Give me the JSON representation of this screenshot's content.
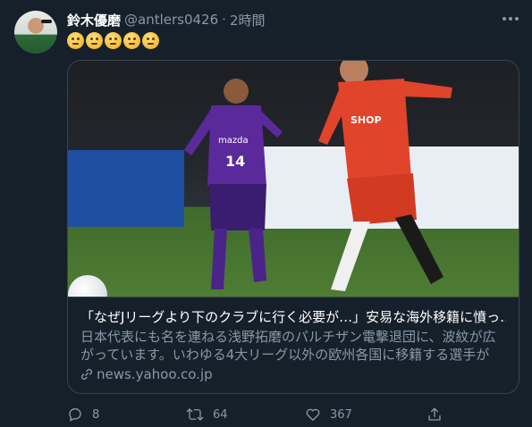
{
  "tweet": {
    "display_name": "鈴木優磨",
    "handle": "@antlers0426",
    "separator": "·",
    "time": "2時間",
    "emoji_icons": [
      "thinking-face-emoji",
      "thinking-face-emoji",
      "thinking-face-emoji",
      "thinking-face-emoji",
      "thinking-face-emoji"
    ]
  },
  "card": {
    "title": "「なぜJリーグより下のクラブに行く必要が…」安易な海外移籍に憤っ…",
    "description": "日本代表にも名を連ねる浅野拓磨のパルチザン電撃退団に、波紋が広がっています。いわゆる4大リーグ以外の欧州各国に移籍する選手が増…",
    "link": "news.yahoo.co.jp",
    "photo_text": {
      "player1_number": "14",
      "player1_sponsor": "mazda",
      "player2_sponsor": "SHOP"
    }
  },
  "actions": {
    "replies": "8",
    "retweets": "64",
    "likes": "367"
  },
  "colors": {
    "background": "#15202b",
    "secondary_text": "#8899a6",
    "border": "#38444d"
  }
}
